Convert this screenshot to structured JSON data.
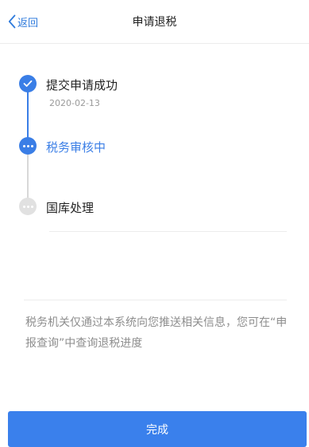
{
  "header": {
    "back_label": "返回",
    "title": "申请退税"
  },
  "timeline": {
    "steps": [
      {
        "label": "提交申请成功",
        "date": "2020-02-13",
        "status": "done"
      },
      {
        "label": "税务审核中",
        "status": "current"
      },
      {
        "label": "国库处理",
        "status": "pending"
      }
    ]
  },
  "notice": "税务机关仅通过本系统向您推送相关信息，您可在“申报查询”中查询退税进度",
  "footer": {
    "done_label": "完成"
  },
  "colors": {
    "accent": "#3a7ee6",
    "pending": "#e1e1e1",
    "muted_text": "#8e8e8e"
  }
}
